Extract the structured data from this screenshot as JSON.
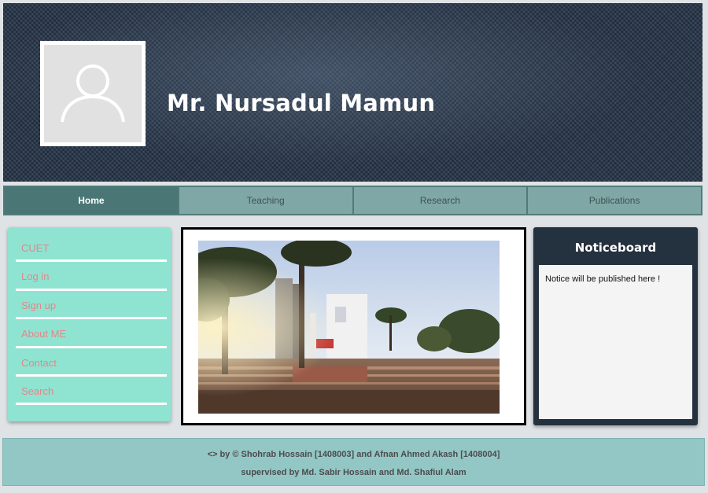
{
  "header": {
    "name": "Mr. Nursadul Mamun",
    "avatar_icon": "user-placeholder-icon",
    "background_color": "#27364a"
  },
  "nav": {
    "items": [
      {
        "label": "Home",
        "active": true
      },
      {
        "label": "Teaching",
        "active": false
      },
      {
        "label": "Research",
        "active": false
      },
      {
        "label": "Publications",
        "active": false
      }
    ],
    "active_color": "#4a7775",
    "item_color": "#7fa7a5"
  },
  "sidebar": {
    "items": [
      {
        "label": "CUET"
      },
      {
        "label": "Log in"
      },
      {
        "label": "Sign up"
      },
      {
        "label": "About ME"
      },
      {
        "label": "Contact"
      },
      {
        "label": "Search"
      }
    ],
    "background_color": "#8fe4d1",
    "link_color": "#e3868a"
  },
  "noticeboard": {
    "title": "Noticeboard",
    "message": "Notice will be published here !"
  },
  "footer": {
    "credits": "<> by © Shohrab Hossain [1408003] and Afnan Ahmed Akash [1408004]",
    "supervisors": "supervised by Md. Sabir Hossain and Md. Shafiul Alam"
  }
}
